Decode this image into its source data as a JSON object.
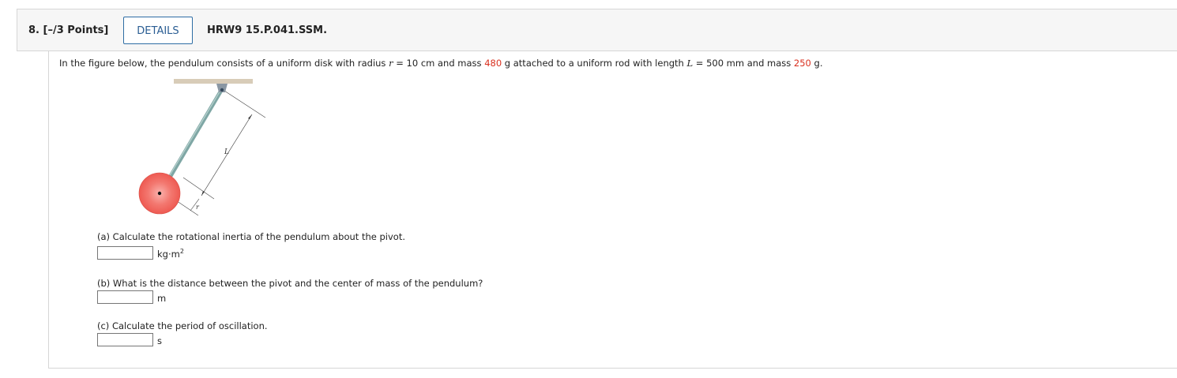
{
  "question": {
    "number_label": "8.",
    "points_label": "[–/3 Points]",
    "details_label": "DETAILS",
    "code": "HRW9 15.P.041.SSM."
  },
  "prompt": {
    "part1": "In the figure below, the pendulum consists of a uniform disk with radius ",
    "var_r": "r",
    "part2": " = 10 cm and mass ",
    "disk_mass": "480",
    "part3": " g attached to a uniform rod with length ",
    "var_L": "L",
    "part4": " = 500 mm and mass ",
    "rod_mass": "250",
    "part5": " g."
  },
  "figure": {
    "label_L": "L",
    "label_r": "r",
    "colors": {
      "ceiling": "#d8ccb8",
      "rod": "#7fa7a5",
      "pivot": "#8a97a3",
      "disk": "#f26a63",
      "disk_center": "#e23a36"
    }
  },
  "parts": [
    {
      "prompt": "(a) Calculate the rotational inertia of the pendulum about the pivot.",
      "value": "",
      "unit_base": "kg·m",
      "unit_exp": "2"
    },
    {
      "prompt": "(b) What is the distance between the pivot and the center of mass of the pendulum?",
      "value": "",
      "unit_base": "m",
      "unit_exp": ""
    },
    {
      "prompt": "(c) Calculate the period of oscillation.",
      "value": "",
      "unit_base": "s",
      "unit_exp": ""
    }
  ]
}
